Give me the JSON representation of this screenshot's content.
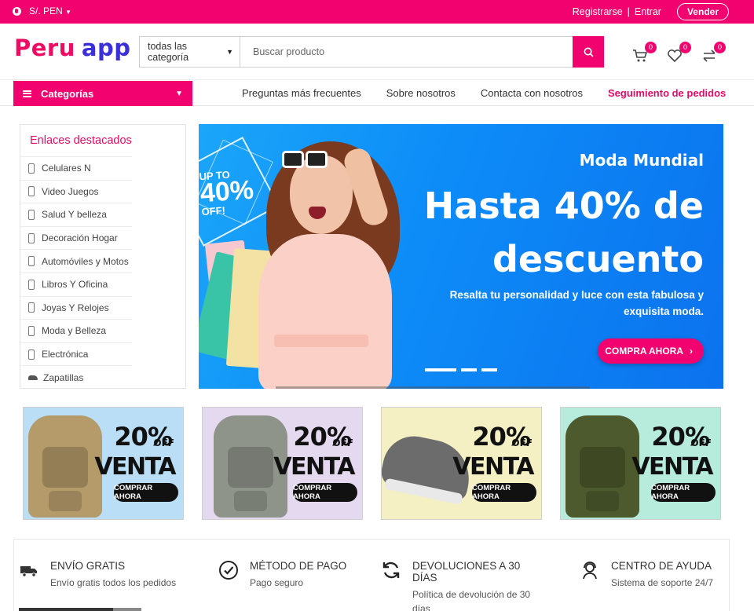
{
  "topbar": {
    "currency": "S/. PEN",
    "register": "Registrarse",
    "separator": "|",
    "login": "Entrar",
    "sell": "Vender"
  },
  "header": {
    "logo_word1": "Peru",
    "logo_word2": "app",
    "category_select": "todas las categoría",
    "search_placeholder": "Buscar producto",
    "cart_count": "0",
    "wishlist_count": "0",
    "compare_count": "0"
  },
  "nav": {
    "categories_label": "Categorías",
    "links": [
      "Preguntas más frecuentes",
      "Sobre nosotros",
      "Contacta con nosotros"
    ],
    "active_link": "Seguimiento de pedidos"
  },
  "sidebar": {
    "title": "Enlaces destacados",
    "items": [
      {
        "label": "Celulares N",
        "icon": "phone-icon"
      },
      {
        "label": "Video Juegos",
        "icon": "phone-icon"
      },
      {
        "label": "Salud Y belleza",
        "icon": "phone-icon"
      },
      {
        "label": "Decoración Hogar",
        "icon": "phone-icon"
      },
      {
        "label": "Automóviles y Motos",
        "icon": "phone-icon"
      },
      {
        "label": "Libros Y Oficina",
        "icon": "phone-icon"
      },
      {
        "label": "Joyas Y Relojes",
        "icon": "phone-icon"
      },
      {
        "label": "Moda y Belleza",
        "icon": "phone-icon"
      },
      {
        "label": "Electrónica",
        "icon": "phone-icon"
      },
      {
        "label": "Zapatillas",
        "icon": "shoe-icon"
      }
    ]
  },
  "hero": {
    "promo_line1": "UP TO",
    "promo_line2": "40%",
    "promo_line3": "OFF!",
    "eyebrow": "Moda Mundial",
    "headline": "Hasta 40% de descuento",
    "subtitle": "Resalta tu personalidad y luce con esta fabulosa y exquisita moda.",
    "cta": "COMPRA AHORA"
  },
  "promos": [
    {
      "pct": "20%",
      "off": "OFF",
      "venta": "VENTA",
      "button": "COMPRAR AHORA",
      "bg": "#b9def5",
      "item": "backpack",
      "color": "#b59a6a"
    },
    {
      "pct": "20%",
      "off": "OFF",
      "venta": "VENTA",
      "button": "COMPRAR AHORA",
      "bg": "#e5d9f0",
      "item": "backpack",
      "color": "#8f948a"
    },
    {
      "pct": "20%",
      "off": "OFF",
      "venta": "VENTA",
      "button": "COMPRAR AHORA",
      "bg": "#f5efc4",
      "item": "shoe",
      "color": "#6c6c6c"
    },
    {
      "pct": "20%",
      "off": "OFF",
      "venta": "VENTA",
      "button": "COMPRAR AHORA",
      "bg": "#b7ecdd",
      "item": "backpack",
      "color": "#4c5a2d"
    }
  ],
  "features": [
    {
      "title": "ENVÍO GRATIS",
      "desc": "Envío gratis todos los pedidos",
      "icon": "truck-icon"
    },
    {
      "title": "MÉTODO DE PAGO",
      "desc": "Pago seguro",
      "icon": "check-circle-icon"
    },
    {
      "title": "DEVOLUCIONES A 30 DÍAS",
      "desc": "Política de devolución de 30 días",
      "icon": "refresh-icon"
    },
    {
      "title": "CENTRO DE AYUDA",
      "desc": "Sistema de soporte 24/7",
      "icon": "support-agent-icon"
    }
  ],
  "colors": {
    "accent": "#f2026e",
    "brand_blue": "#3a2fd8"
  }
}
